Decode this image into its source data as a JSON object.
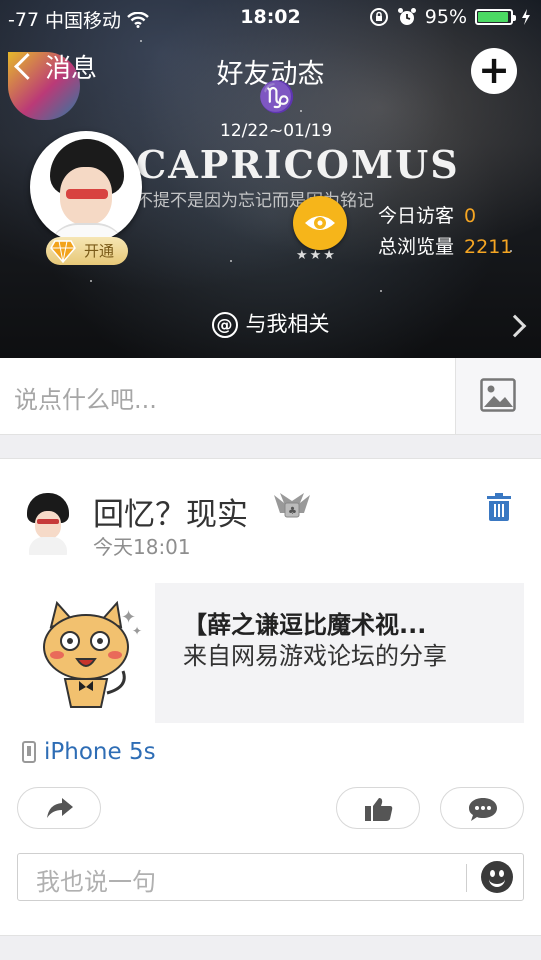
{
  "status_bar": {
    "signal": "-77",
    "carrier": "中国移动",
    "time": "18:02",
    "battery_percent": "95%",
    "battery_level": 0.95,
    "battery_color": "#4cd964"
  },
  "nav": {
    "back_label": "消息",
    "title": "好友动态",
    "add_icon": "plus-icon"
  },
  "profile": {
    "zodiac_glyph": "♑",
    "zodiac_dates": "12/22~01/19",
    "zodiac_name": "CAPRICOMUS",
    "motto": "不提不是因为忘记而是因为铭记",
    "vip_badge": "开通",
    "eye_stars": "★★★",
    "visits_today_label": "今日访客",
    "visits_today": "0",
    "total_views_label": "总浏览量",
    "total_views": "2211",
    "number_color": "#f6a623"
  },
  "mention": {
    "label": "与我相关"
  },
  "compose": {
    "placeholder": "说点什么吧..."
  },
  "post": {
    "title": "回忆？现实",
    "time": "今天18:01",
    "share_title": "【薛之谦逗比魔术视...",
    "share_source": "来自网易游戏论坛的分享",
    "device": "iPhone 5s",
    "device_color": "#2e6db5",
    "comment_placeholder": "我也说一句"
  }
}
